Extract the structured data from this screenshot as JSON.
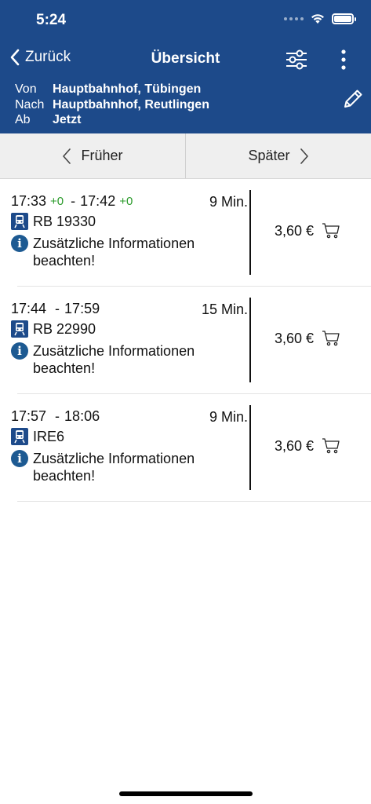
{
  "status_bar": {
    "time": "5:24"
  },
  "nav": {
    "back_label": "Zurück",
    "title": "Übersicht"
  },
  "route": {
    "from_key": "Von",
    "from_value": "Hauptbahnhof, Tübingen",
    "to_key": "Nach",
    "to_value": "Hauptbahnhof, Reutlingen",
    "when_key": "Ab",
    "when_value": "Jetzt"
  },
  "pager": {
    "earlier": "Früher",
    "later": "Später"
  },
  "connections": [
    {
      "departure": "17:33",
      "departure_delay": "+0",
      "arrival": "17:42",
      "arrival_delay": "+0",
      "duration": "9 Min.",
      "train": "RB 19330",
      "info": "Zusätzliche Informationen beachten!",
      "price": "3,60 €"
    },
    {
      "departure": "17:44",
      "departure_delay": "",
      "arrival": "17:59",
      "arrival_delay": "",
      "duration": "15 Min.",
      "train": "RB 22990",
      "info": "Zusätzliche Informationen beachten!",
      "price": "3,60 €"
    },
    {
      "departure": "17:57",
      "departure_delay": "",
      "arrival": "18:06",
      "arrival_delay": "",
      "duration": "9 Min.",
      "train": "IRE6",
      "info": "Zusätzliche Informationen beachten!",
      "price": "3,60 €"
    }
  ],
  "colors": {
    "header": "#1d4a8a",
    "delay": "#2a9a2a",
    "info_icon": "#1d5a92"
  },
  "icons": [
    "chevron-left-icon",
    "filter-sliders-icon",
    "more-vertical-icon",
    "pencil-icon",
    "chevron-right-icon",
    "train-icon",
    "info-icon",
    "cart-icon",
    "wifi-icon",
    "battery-icon"
  ]
}
